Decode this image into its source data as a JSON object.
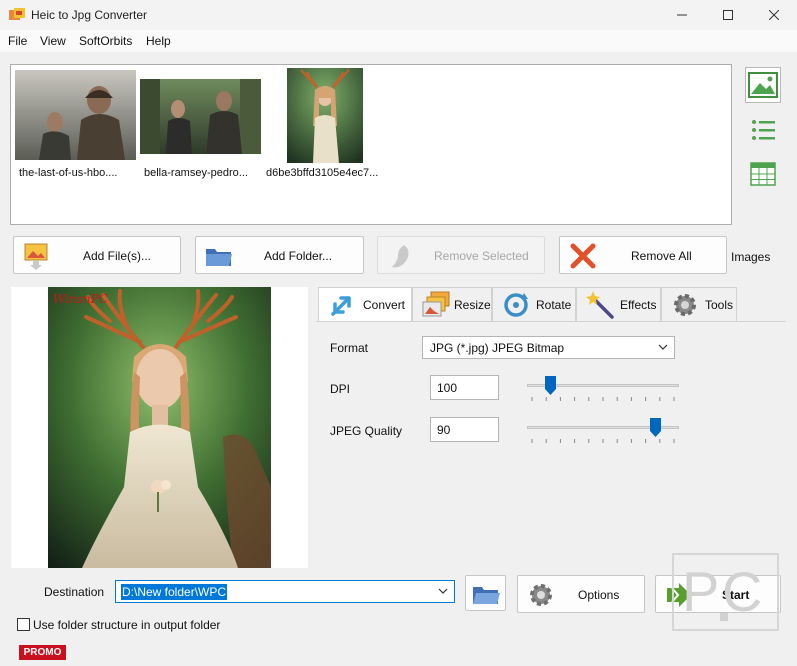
{
  "window": {
    "title": "Heic to Jpg Converter"
  },
  "menu": [
    "File",
    "View",
    "SoftOrbits",
    "Help"
  ],
  "thumbnails": [
    {
      "caption": "the-last-of-us-hbo...."
    },
    {
      "caption": "bella-ramsey-pedro..."
    },
    {
      "caption": "d6be3bffd3105e4ec7..."
    }
  ],
  "side_icons": [
    "image-view-icon",
    "list-view-icon",
    "grid-view-icon"
  ],
  "buttons": {
    "add_files": "Add File(s)...",
    "add_folder": "Add Folder...",
    "remove_selected": "Remove Selected",
    "remove_all": "Remove All",
    "images_label": "Images"
  },
  "preview": {
    "watermark": "WinsnPC"
  },
  "tabs": [
    {
      "label": "Convert",
      "icon": "convert-icon",
      "active": true
    },
    {
      "label": "Resize",
      "icon": "resize-icon",
      "active": false
    },
    {
      "label": "Rotate",
      "icon": "rotate-icon",
      "active": false
    },
    {
      "label": "Effects",
      "icon": "effects-icon",
      "active": false
    },
    {
      "label": "Tools",
      "icon": "tools-icon",
      "active": false
    }
  ],
  "convert": {
    "format_label": "Format",
    "format_value": "JPG (*.jpg) JPEG Bitmap",
    "dpi_label": "DPI",
    "dpi_value": "100",
    "dpi_slider_fraction": 0.13,
    "quality_label": "JPEG Quality",
    "quality_value": "90",
    "quality_slider_fraction": 0.87
  },
  "bottom": {
    "destination_label": "Destination",
    "destination_value": "D:\\New folder\\WPC",
    "options_label": "Options",
    "start_label": "Start",
    "checkbox_label": "Use folder structure in output folder",
    "promo": "PROMO"
  },
  "colors": {
    "accent": "#0078d7",
    "remove_red": "#e4502a",
    "promo_red": "#c8101e",
    "start_green": "#5a9e2f"
  }
}
